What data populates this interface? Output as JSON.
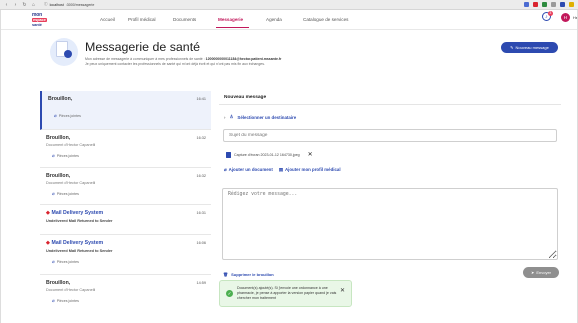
{
  "browser": {
    "url_host": "localhost",
    "url_path": ":3000/messagerie",
    "nav_icons": [
      "back-arrow",
      "forward-arrow",
      "reload",
      "home"
    ],
    "ext_colors": [
      "#4b6bd1",
      "#d9232e",
      "#2d8a3e",
      "#999999",
      "#2d4ab0",
      "#e0b000"
    ]
  },
  "logo": {
    "line1": "mon",
    "line2": "espace",
    "line3": "santé"
  },
  "nav": {
    "items": [
      {
        "label": "Accueil",
        "active": false
      },
      {
        "label": "Profil médical",
        "active": false
      },
      {
        "label": "Documents",
        "active": false
      },
      {
        "label": "Messagerie",
        "active": true
      },
      {
        "label": "Agenda",
        "active": false
      },
      {
        "label": "Catalogue de services",
        "active": false
      }
    ]
  },
  "account": {
    "notification_count": "3",
    "avatar_initial": "H",
    "name": "He"
  },
  "header": {
    "title": "Messagerie de santé",
    "desc_prefix": "Mon adresse de messagerie à communiquer à mes professionnels de santé : ",
    "email": "1200000000011184@hector.patient.mssante.fr",
    "desc_suffix": "Je peux uniquement contacter les professionnels de santé qui m'ont déjà écrit et qui n'ont pas mis fin aux échanges.",
    "new_message_label": "Nouveau message"
  },
  "messages": [
    {
      "from": "Brouillon,",
      "time": "16:41",
      "subject": "",
      "attachment": "Pièces jointes",
      "flag": false,
      "bold_subject": false
    },
    {
      "from": "Brouillon,",
      "time": "16:32",
      "subject": "Document d'Hector Capanelli",
      "attachment": "Pièces jointes",
      "flag": false,
      "bold_subject": false
    },
    {
      "from": "Brouillon,",
      "time": "16:32",
      "subject": "Document d'Hector Capanelli",
      "attachment": "Pièces jointes",
      "flag": false,
      "bold_subject": false
    },
    {
      "from": "Mail Delivery System",
      "time": "16:31",
      "subject": "Undelivered Mail Returned to Sender",
      "attachment": "",
      "flag": true,
      "bold_subject": true
    },
    {
      "from": "Mail Delivery System",
      "time": "16:06",
      "subject": "Undelivered Mail Returned to Sender",
      "attachment": "Pièces jointes",
      "flag": true,
      "bold_subject": true
    },
    {
      "from": "Brouillon,",
      "time": "14:59",
      "subject": "Document d'Hector Capanelli",
      "attachment": "Pièces jointes",
      "flag": false,
      "bold_subject": false
    }
  ],
  "compose": {
    "heading": "Nouveau message",
    "recipient_label": "Sélectionner un destinataire",
    "subject_placeholder": "Sujet du message",
    "attachment_name": "Capture d'écran 2023-01-12 164730.jpeg",
    "add_document": "Ajouter un document",
    "add_medical_profile": "Ajouter mon profil médical",
    "body_placeholder": "Rédigez votre message...",
    "delete_draft": "Supprimer le brouillon",
    "send": "Envoyer"
  },
  "toast": {
    "text": "Document(s) ajouté(s). Si j'envoie une ordonnance à une pharmacie, je pense à apporter la version papier quand je vais chercher mon traitement"
  }
}
